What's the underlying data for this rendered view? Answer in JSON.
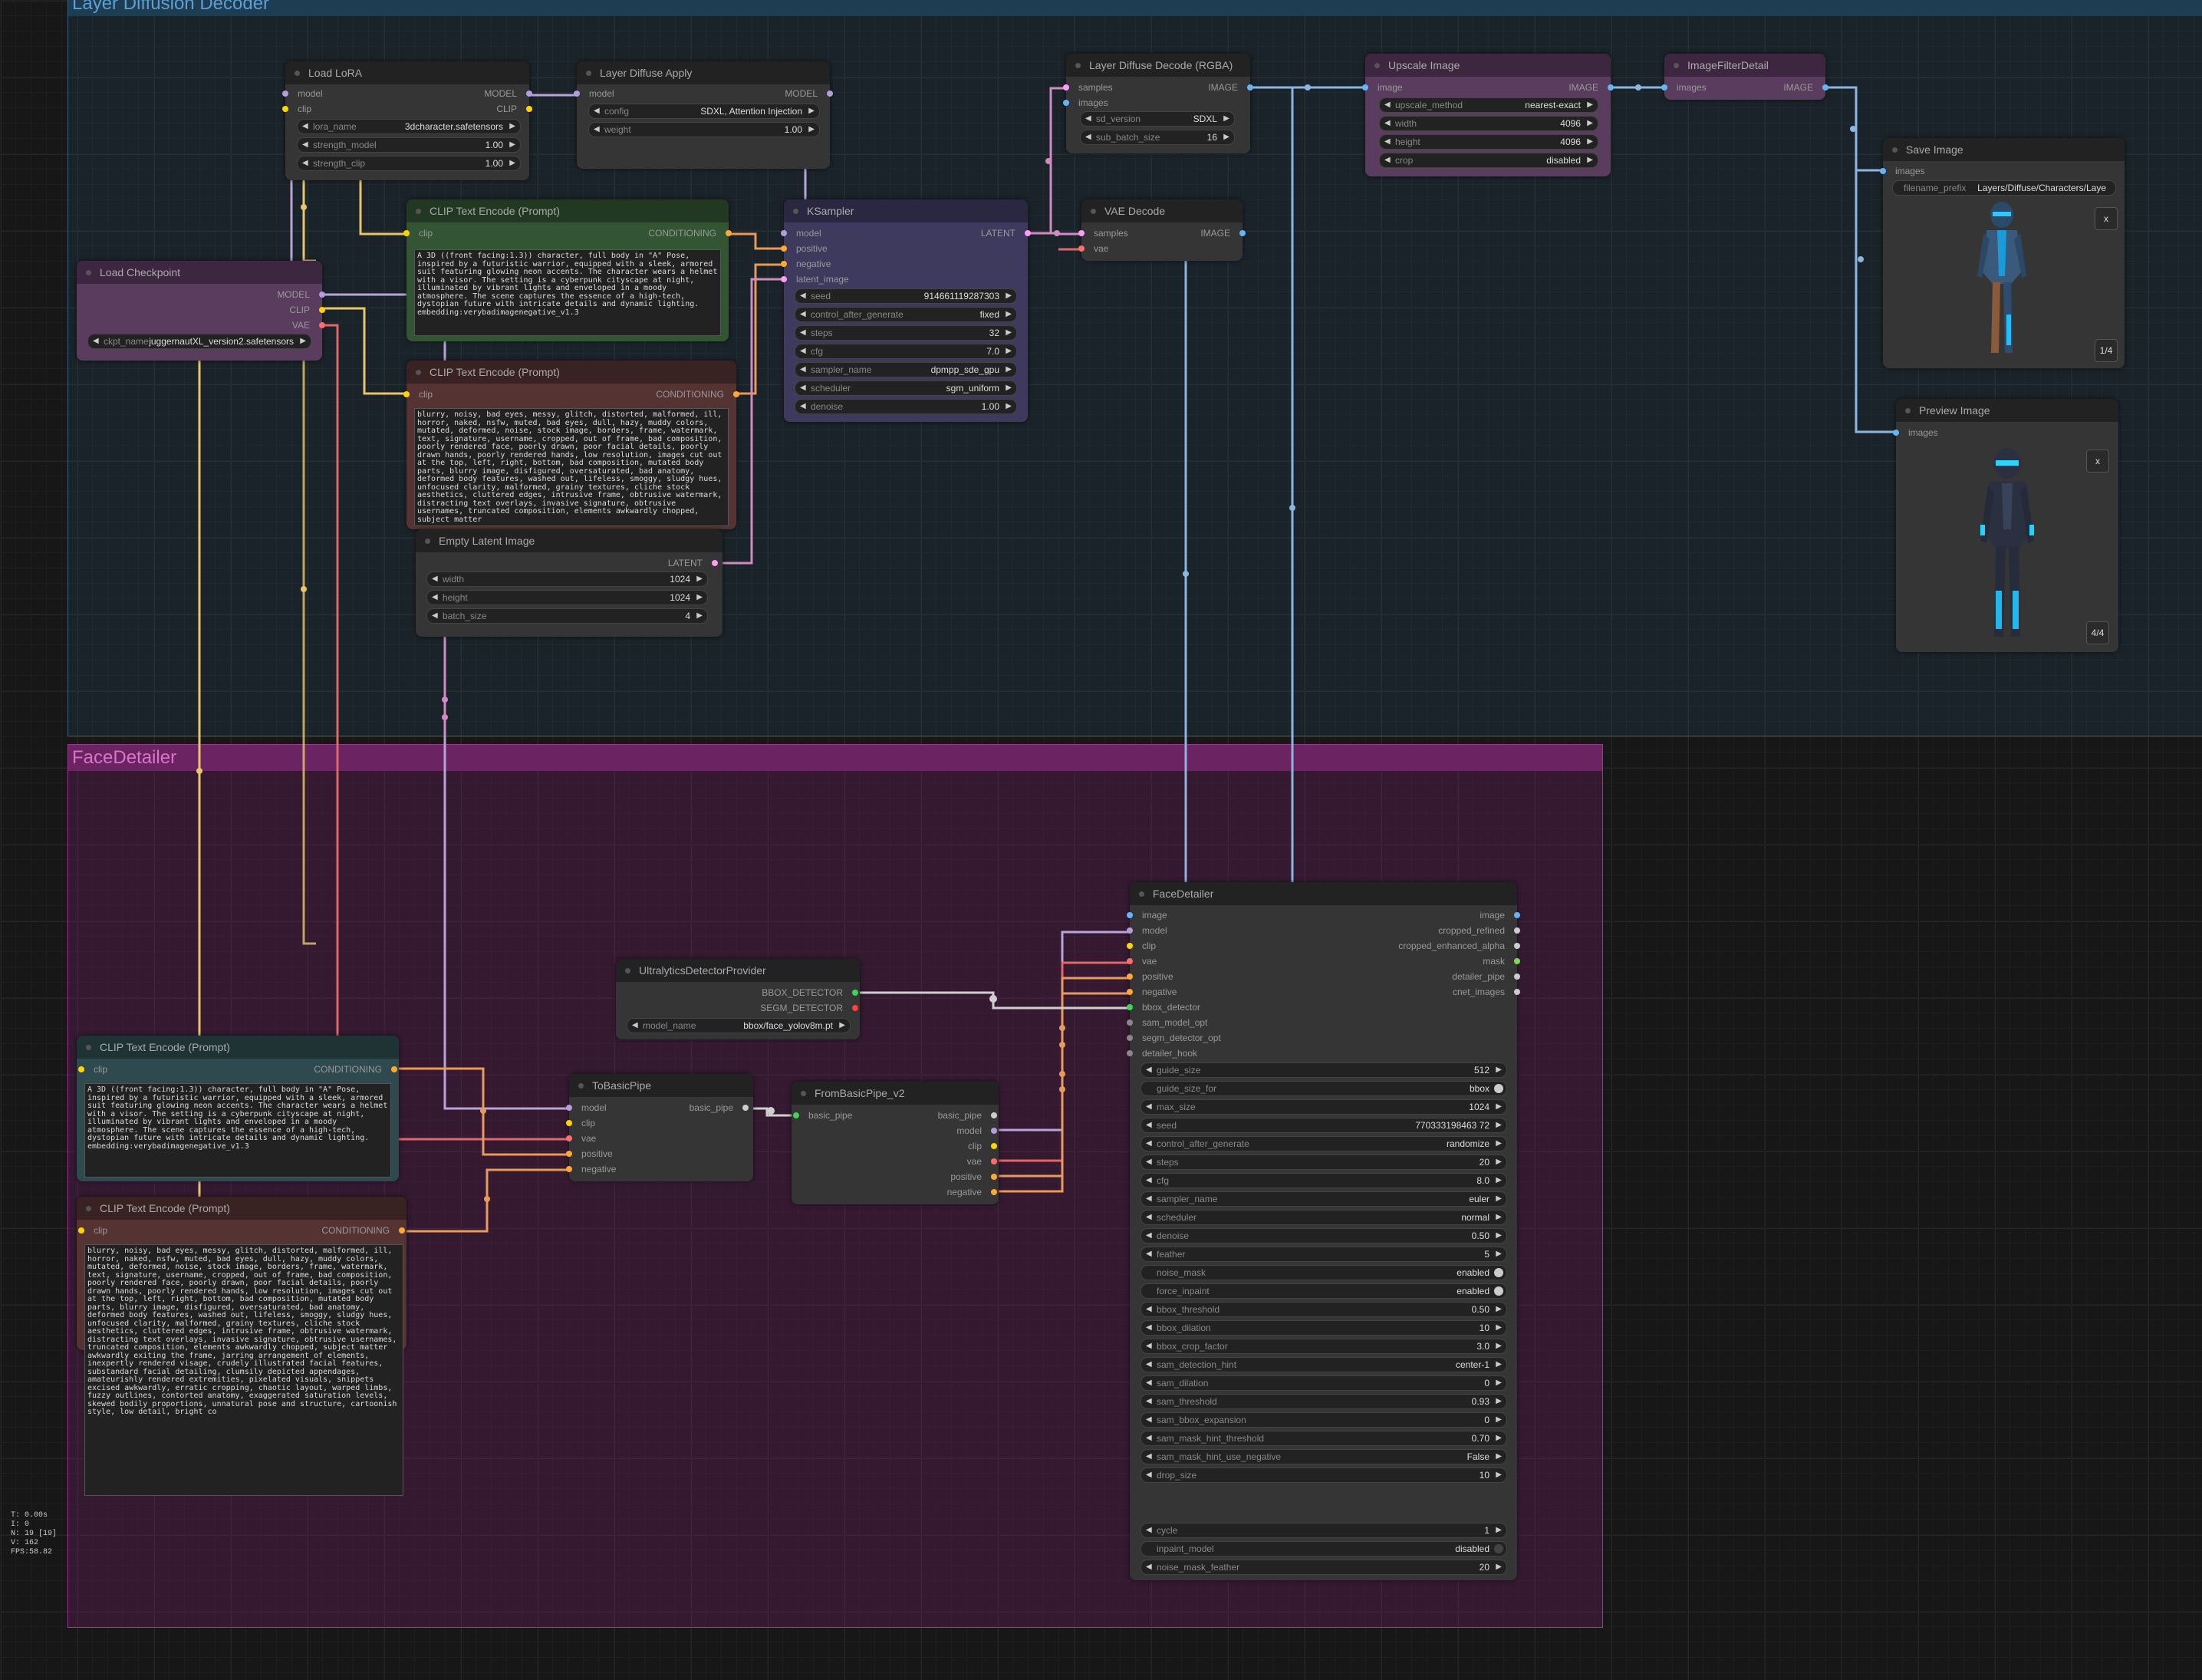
{
  "groups": {
    "layer_diffusion": "Layer Diffusion Decoder",
    "face_detailer": "FaceDetailer"
  },
  "nodes": {
    "load_lora": {
      "title": "Load LoRA",
      "in_model": "model",
      "in_clip": "clip",
      "out_model": "MODEL",
      "out_clip": "CLIP",
      "w_lora_name": "lora_name",
      "v_lora_name": "3dcharacter.safetensors",
      "w_strength_model": "strength_model",
      "v_strength_model": "1.00",
      "w_strength_clip": "strength_clip",
      "v_strength_clip": "1.00"
    },
    "layer_diffuse_apply": {
      "title": "Layer Diffuse Apply",
      "in_model": "model",
      "out_model": "MODEL",
      "w_config": "config",
      "v_config": "SDXL, Attention Injection",
      "w_weight": "weight",
      "v_weight": "1.00"
    },
    "layer_diffuse_decode": {
      "title": "Layer Diffuse Decode (RGBA)",
      "in_samples": "samples",
      "in_images": "images",
      "out_image": "IMAGE",
      "w_sd_version": "sd_version",
      "v_sd_version": "SDXL",
      "w_sub_batch_size": "sub_batch_size",
      "v_sub_batch_size": "16"
    },
    "upscale_image": {
      "title": "Upscale Image",
      "in_image": "image",
      "out_image": "IMAGE",
      "w_upscale_method": "upscale_method",
      "v_upscale_method": "nearest-exact",
      "w_width": "width",
      "v_width": "4096",
      "w_height": "height",
      "v_height": "4096",
      "w_crop": "crop",
      "v_crop": "disabled"
    },
    "image_filter": {
      "title": "ImageFilterDetail",
      "in_images": "images",
      "out_image": "IMAGE"
    },
    "save_image": {
      "title": "Save Image",
      "in_images": "images",
      "w_filename_prefix": "filename_prefix",
      "v_filename_prefix": "Layers/Diffuse/Characters/Laye",
      "close": "x",
      "counter": "1/4"
    },
    "preview_image": {
      "title": "Preview Image",
      "in_images": "images",
      "close": "x",
      "counter": "4/4"
    },
    "clip_pos_top": {
      "title": "CLIP Text Encode (Prompt)",
      "in_clip": "clip",
      "out_cond": "CONDITIONING",
      "text": "A 3D ((front facing:1.3)) character, full body in \"A\" Pose, inspired by a futuristic warrior, equipped with a sleek, armored suit featuring glowing neon accents. The character wears a helmet with a visor. The setting is a cyberpunk cityscape at night, illuminated by vibrant lights and enveloped in a moody atmosphere. The scene captures the essence of a high-tech, dystopian future with intricate details and dynamic lighting.\nembedding:verybadimagenegative_v1.3"
    },
    "clip_neg_top": {
      "title": "CLIP Text Encode (Prompt)",
      "in_clip": "clip",
      "out_cond": "CONDITIONING",
      "text": "blurry, noisy, bad eyes, messy, glitch, distorted, malformed, ill, horror, naked, nsfw, muted, bad eyes, dull, hazy, muddy colors, mutated, deformed, noise, stock image, borders, frame, watermark, text, signature, username, cropped, out of frame, bad composition, poorly rendered face, poorly drawn, poor facial details, poorly drawn hands, poorly rendered hands, low resolution, images cut out at the top, left, right, bottom, bad composition, mutated body parts, blurry image, disfigured, oversaturated, bad anatomy, deformed body features, washed out, lifeless, smoggy, sludgy hues, unfocused clarity, malformed, grainy textures, cliche stock aesthetics, cluttered edges, intrusive frame, obtrusive watermark, distracting text overlays, invasive signature, obtrusive usernames, truncated composition, elements awkwardly chopped, subject matter"
    },
    "load_checkpoint": {
      "title": "Load Checkpoint",
      "out_model": "MODEL",
      "out_clip": "CLIP",
      "out_vae": "VAE",
      "w_ckpt_name": "ckpt_name",
      "v_ckpt_name": "juggernautXL_version2.safetensors"
    },
    "ksampler": {
      "title": "KSampler",
      "in_model": "model",
      "in_positive": "positive",
      "in_negative": "negative",
      "in_latent": "latent_image",
      "out_latent": "LATENT",
      "w_seed": "seed",
      "v_seed": "914661119287303",
      "w_control": "control_after_generate",
      "v_control": "fixed",
      "w_steps": "steps",
      "v_steps": "32",
      "w_cfg": "cfg",
      "v_cfg": "7.0",
      "w_sampler": "sampler_name",
      "v_sampler": "dpmpp_sde_gpu",
      "w_scheduler": "scheduler",
      "v_scheduler": "sgm_uniform",
      "w_denoise": "denoise",
      "v_denoise": "1.00"
    },
    "vae_decode": {
      "title": "VAE Decode",
      "in_samples": "samples",
      "in_vae": "vae",
      "out_image": "IMAGE"
    },
    "empty_latent": {
      "title": "Empty Latent Image",
      "out_latent": "LATENT",
      "w_width": "width",
      "v_width": "1024",
      "w_height": "height",
      "v_height": "1024",
      "w_batch": "batch_size",
      "v_batch": "4"
    },
    "ultralytics": {
      "title": "UltralyticsDetectorProvider",
      "out_bbox": "BBOX_DETECTOR",
      "out_segm": "SEGM_DETECTOR",
      "w_model_name": "model_name",
      "v_model_name": "bbox/face_yolov8m.pt"
    },
    "to_basic_pipe": {
      "title": "ToBasicPipe",
      "in_model": "model",
      "in_clip": "clip",
      "in_vae": "vae",
      "in_positive": "positive",
      "in_negative": "negative",
      "out_pipe": "basic_pipe"
    },
    "from_basic_pipe": {
      "title": "FromBasicPipe_v2",
      "in_pipe": "basic_pipe",
      "out_pipe": "basic_pipe",
      "out_model": "model",
      "out_clip": "clip",
      "out_vae": "vae",
      "out_positive": "positive",
      "out_negative": "negative"
    },
    "clip_pos_bottom": {
      "title": "CLIP Text Encode (Prompt)",
      "in_clip": "clip",
      "out_cond": "CONDITIONING",
      "text": "A 3D ((front facing:1.3)) character, full body in \"A\" Pose, inspired by a futuristic warrior, equipped with a sleek, armored suit featuring glowing neon accents. The character wears a helmet with a visor. The setting is a cyberpunk cityscape at night, illuminated by vibrant lights and enveloped in a moody atmosphere. The scene captures the essence of a high-tech, dystopian future with intricate details and dynamic lighting.\nembedding:verybadimagenegative_v1.3"
    },
    "clip_neg_bottom": {
      "title": "CLIP Text Encode (Prompt)",
      "in_clip": "clip",
      "out_cond": "CONDITIONING",
      "text": "blurry, noisy, bad eyes, messy, glitch, distorted, malformed, ill, horror, naked, nsfw, muted, bad eyes, dull, hazy, muddy colors, mutated, deformed, noise, stock image, borders, frame, watermark, text, signature, username, cropped, out of frame, bad composition, poorly rendered face, poorly drawn, poor facial details, poorly drawn hands, poorly rendered hands, low resolution, images cut out at the top, left, right, bottom, bad composition, mutated body parts, blurry image, disfigured, oversaturated, bad anatomy, deformed body features, washed out, lifeless, smoggy, sludgy hues, unfocused clarity, malformed, grainy textures, cliche stock aesthetics, cluttered edges, intrusive frame, obtrusive watermark, distracting text overlays, invasive signature, obtrusive usernames, truncated composition, elements awkwardly chopped, subject matter awkwardly exiting the frame, jarring arrangement of elements, inexpertly rendered visage, crudely illustrated facial features, substandard facial detailing, clumsily depicted appendages, amateurishly rendered extremities, pixelated visuals, snippets excised awkwardly, erratic cropping, chaotic layout, warped limbs, fuzzy outlines, contorted anatomy, exaggerated saturation levels, skewed bodily proportions, unnatural pose and structure, cartoonish style, low detail, bright co"
    },
    "face_detailer": {
      "title": "FaceDetailer",
      "inputs": [
        "image",
        "model",
        "clip",
        "vae",
        "positive",
        "negative",
        "bbox_detector",
        "sam_model_opt",
        "segm_detector_opt",
        "detailer_hook"
      ],
      "outputs": [
        "image",
        "cropped_refined",
        "cropped_enhanced_alpha",
        "mask",
        "detailer_pipe",
        "cnet_images"
      ],
      "widgets": [
        {
          "name": "guide_size",
          "value": "512"
        },
        {
          "name": "guide_size_for",
          "value": "bbox",
          "toggle": true
        },
        {
          "name": "max_size",
          "value": "1024"
        },
        {
          "name": "seed",
          "value": "770333198463 72"
        },
        {
          "name": "control_after_generate",
          "value": "randomize"
        },
        {
          "name": "steps",
          "value": "20"
        },
        {
          "name": "cfg",
          "value": "8.0"
        },
        {
          "name": "sampler_name",
          "value": "euler"
        },
        {
          "name": "scheduler",
          "value": "normal"
        },
        {
          "name": "denoise",
          "value": "0.50"
        },
        {
          "name": "feather",
          "value": "5"
        },
        {
          "name": "noise_mask",
          "value": "enabled",
          "toggle": true
        },
        {
          "name": "force_inpaint",
          "value": "enabled",
          "toggle": true
        },
        {
          "name": "bbox_threshold",
          "value": "0.50"
        },
        {
          "name": "bbox_dilation",
          "value": "10"
        },
        {
          "name": "bbox_crop_factor",
          "value": "3.0"
        },
        {
          "name": "sam_detection_hint",
          "value": "center-1"
        },
        {
          "name": "sam_dilation",
          "value": "0"
        },
        {
          "name": "sam_threshold",
          "value": "0.93"
        },
        {
          "name": "sam_bbox_expansion",
          "value": "0"
        },
        {
          "name": "sam_mask_hint_threshold",
          "value": "0.70"
        },
        {
          "name": "sam_mask_hint_use_negative",
          "value": "False"
        },
        {
          "name": "drop_size",
          "value": "10"
        }
      ],
      "widgets2": [
        {
          "name": "cycle",
          "value": "1"
        },
        {
          "name": "inpaint_model",
          "value": "disabled",
          "toggle": true,
          "off": true
        },
        {
          "name": "noise_mask_feather",
          "value": "20"
        }
      ]
    }
  },
  "stats": [
    "T: 0.00s",
    "I: 0",
    "N: 19 [19]",
    "V: 162",
    "FPS:58.82"
  ],
  "colors": {
    "model": "#b39ddb",
    "clip": "#ffd500",
    "vae": "#ff6e6e",
    "conditioning": "#ffa931",
    "latent": "#ff9cf9",
    "image": "#64b5f6",
    "pipe": "#cccccc"
  }
}
